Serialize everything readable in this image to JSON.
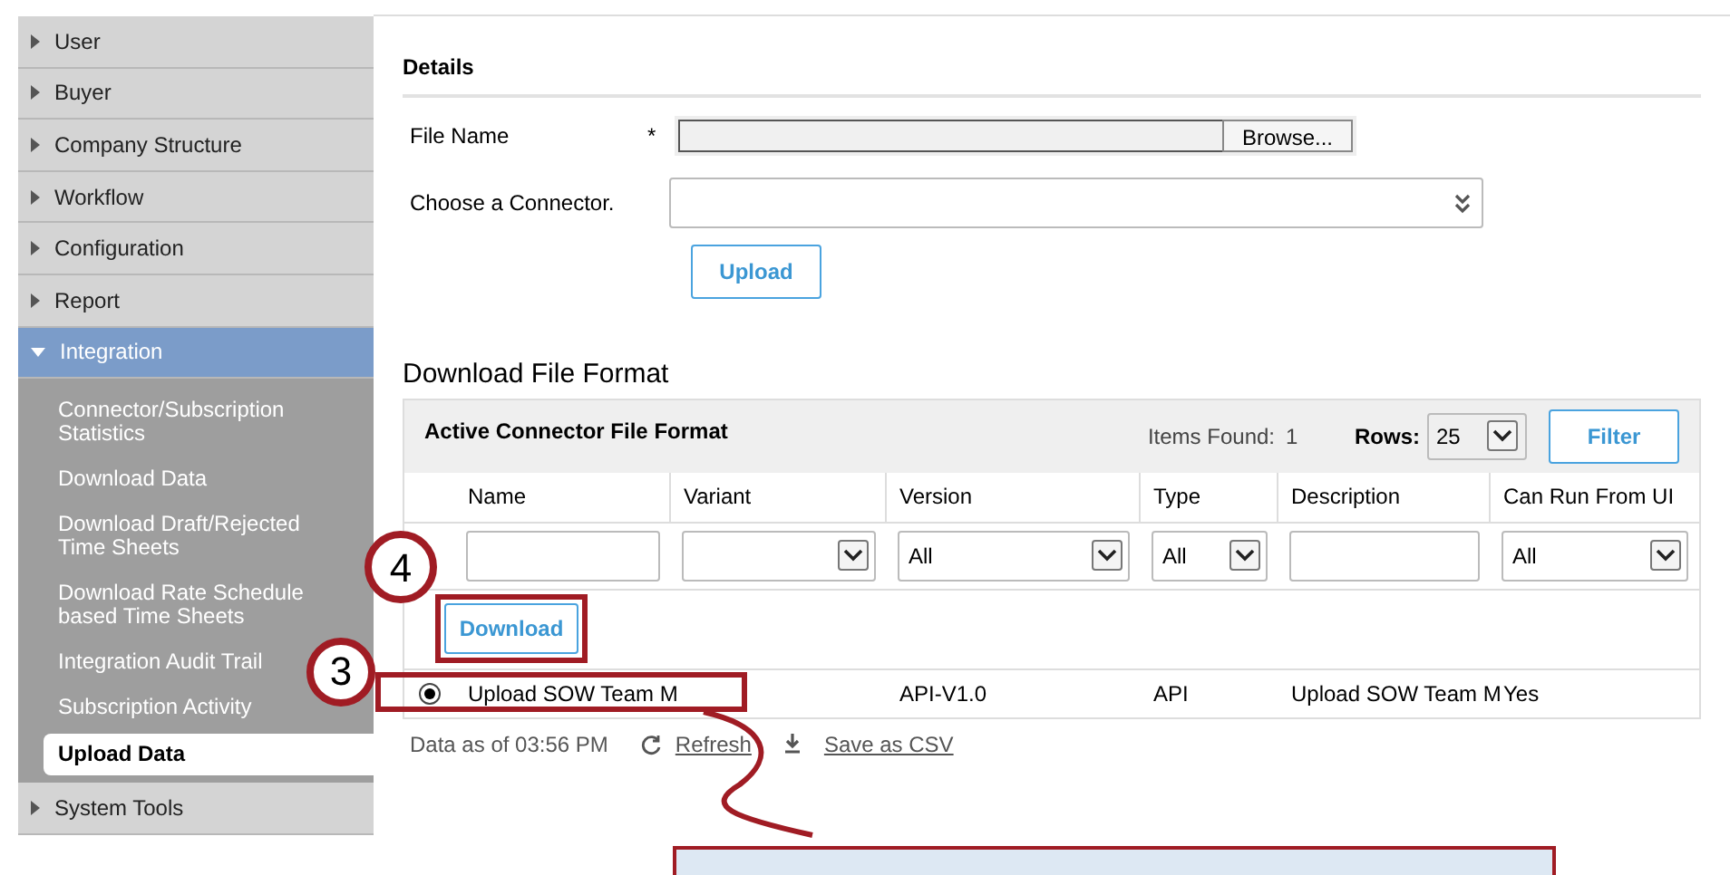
{
  "sidebar": {
    "items": [
      {
        "label": "User",
        "expanded": false
      },
      {
        "label": "Buyer",
        "expanded": false
      },
      {
        "label": "Company Structure",
        "expanded": false
      },
      {
        "label": "Workflow",
        "expanded": false
      },
      {
        "label": "Configuration",
        "expanded": false
      },
      {
        "label": "Report",
        "expanded": false
      },
      {
        "label": "Integration",
        "expanded": true,
        "children": [
          {
            "label": "Connector/Subscription Statistics",
            "selected": false
          },
          {
            "label": "Download Data",
            "selected": false
          },
          {
            "label": "Download Draft/Rejected Time Sheets",
            "selected": false
          },
          {
            "label": "Download Rate Schedule based Time Sheets",
            "selected": false
          },
          {
            "label": "Integration Audit Trail",
            "selected": false
          },
          {
            "label": "Subscription Activity",
            "selected": false
          },
          {
            "label": "Upload Data",
            "selected": true
          }
        ]
      },
      {
        "label": "System Tools",
        "expanded": false
      }
    ]
  },
  "details": {
    "heading": "Details",
    "file_label": "File Name",
    "required_mark": "*",
    "browse_button": "Browse...",
    "connector_label": "Choose a Connector.",
    "upload_button": "Upload"
  },
  "download": {
    "heading": "Download File Format",
    "panel_title": "Active Connector File Format",
    "items_found_label": "Items Found:",
    "items_found": "1",
    "rows_label": "Rows:",
    "rows_value": "25",
    "filter_button": "Filter",
    "columns": [
      "Name",
      "Variant",
      "Version",
      "Type",
      "Description",
      "Can Run From UI"
    ],
    "filters": [
      {
        "kind": "text"
      },
      {
        "kind": "select"
      },
      {
        "kind": "select",
        "value": "All"
      },
      {
        "kind": "select",
        "value": "All"
      },
      {
        "kind": "text"
      },
      {
        "kind": "select",
        "value": "All"
      }
    ],
    "download_button": "Download",
    "rows": [
      {
        "selected": true,
        "cells": [
          "Upload SOW Team M",
          null,
          "API-V1.0",
          "API",
          "Upload SOW Team M",
          "Yes"
        ]
      }
    ],
    "footer": {
      "data_as_of": "Data as of 03:56 PM",
      "refresh": "Refresh",
      "save_csv": "Save as CSV"
    }
  },
  "callouts": [
    {
      "label": "4"
    },
    {
      "label": "3"
    }
  ]
}
